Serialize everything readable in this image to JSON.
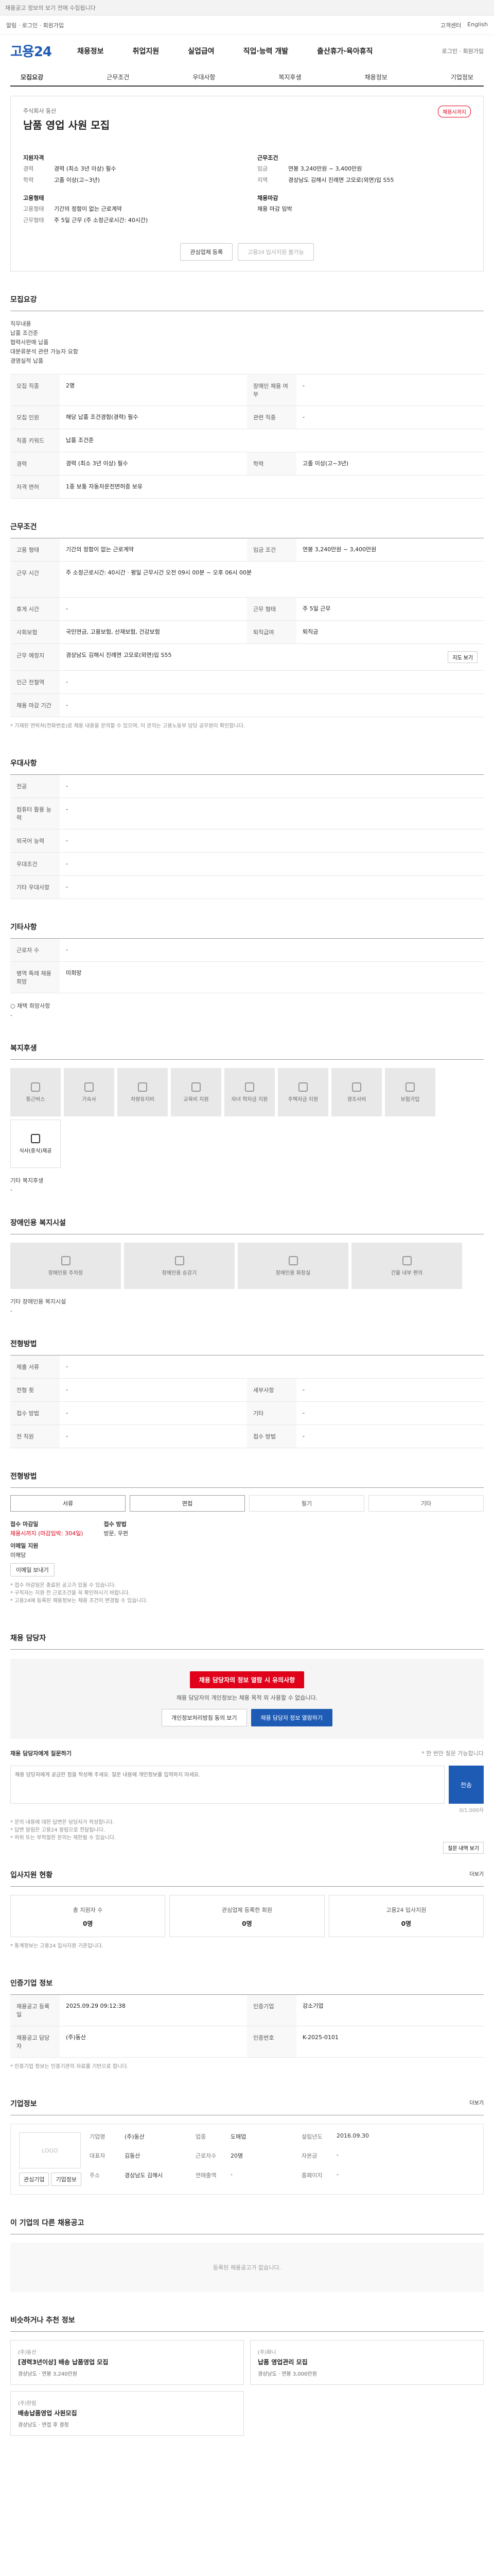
{
  "topbar": {
    "text": "채용공고 정보의 보기 전에 수집됩니다"
  },
  "subtop": {
    "left": "알림 · 로그인 · 회원가입",
    "right_items": [
      "고객센터",
      "English"
    ]
  },
  "header": {
    "logo_main": "고용",
    "logo_num": "24",
    "nav": [
      "채용정보",
      "취업지원",
      "실업급여",
      "직업·능력 개발",
      "출산휴가·육아휴직"
    ],
    "gnb_right": "로그인 · 회원가입"
  },
  "tabs": [
    "모집요강",
    "근무조건",
    "우대사항",
    "복지후생",
    "채용정보",
    "기업정보"
  ],
  "job": {
    "company": "주식회사 동산",
    "title": "남품 영업 사원 모집",
    "badge": "채용시까지",
    "left_title": "지원자격",
    "left": [
      {
        "k": "경력",
        "v": "경력 (최소 3년 이상) 필수"
      },
      {
        "k": "학력",
        "v": "고졸 이상(고~3년)"
      }
    ],
    "left_title2": "고용형태",
    "left2": [
      {
        "k": "고용형태",
        "v": "기간의 정함이 없는 근로계약"
      },
      {
        "k": "근무형태",
        "v": "주 5일 근무 (주 소정근로시간: 40시간)"
      }
    ],
    "right_title": "근무조건",
    "right": [
      {
        "k": "임금",
        "v": "연봉 3,240만원 ~ 3,400만원"
      },
      {
        "k": "지역",
        "v": "경상남도 김해시 진례면 고모로(외면)입 S55"
      }
    ],
    "right_title2": "채용마감",
    "right2": [
      {
        "k": "",
        "v": "채용 마감 임박"
      }
    ],
    "btn1": "관심업체 등록",
    "btn2": "고용24 입사지원 불가능"
  },
  "recruit": {
    "title": "모집요강",
    "desc": [
      "직무내용",
      "납품 조건준",
      "협력사판매 납품",
      "대분류분석 관련 가능자 요함",
      "경영실적 납품"
    ],
    "rows": [
      {
        "k": "모집 직종",
        "v": "2명",
        "k2": "장애인 채용 여부",
        "v2": "-"
      },
      {
        "k": "모집 인원",
        "v": "해당 납품 조건경험(경력) 필수",
        "k2": "관련 직종",
        "v2": "-"
      },
      {
        "k": "직종 키워드",
        "v": "납품 조건준",
        "k2": "",
        "v2": ""
      },
      {
        "k": "경력",
        "v": "경력 (최소 3년 이상) 필수",
        "k2": "학력",
        "v2": "고졸 이상(고~3년)"
      },
      {
        "k": "자격 면허",
        "v": "1종 보통 자동차운전면허증 보유",
        "k2": "",
        "v2": ""
      }
    ]
  },
  "conditions": {
    "title": "근무조건",
    "rows": [
      {
        "k": "고용 형태",
        "v": "기간의 정함이 없는 근로계약",
        "k2": "임금 조건",
        "v2": "연봉 3,240만원 ~ 3,400만원"
      },
      {
        "k": "근무 시간",
        "v": "주 소정근로시간: 40시간 · 평일 근무시간 오전 09시 00분 ~ 오후 06시 00분",
        "k2": "",
        "v2": ""
      },
      {
        "k": "휴게 시간",
        "v": "-",
        "k2": "근무 형태",
        "v2": "주 5일 근무"
      },
      {
        "k": "사회보험",
        "v": "국민연금, 고용보험, 산재보험, 건강보험",
        "k2": "퇴직급여",
        "v2": "퇴직금"
      },
      {
        "k": "근무 예정지",
        "v": "경상남도 김해시 진례면 고모로(외면)입 S55",
        "k2": "",
        "v2": ""
      },
      {
        "k": "인근 전철역",
        "v": "-",
        "k2": "",
        "v2": ""
      },
      {
        "k": "채용 마감 기간",
        "v": "-",
        "k2": "",
        "v2": ""
      }
    ],
    "map_btn": "지도 보기",
    "note": "* 기재된 연락처(전화번호)로 채용 내용을 문의할 수 있으며, 이 문의는 고용노동부 담당 공무원이 확인합니다."
  },
  "prefer": {
    "title": "우대사항",
    "rows": [
      {
        "k": "전공",
        "v": "-"
      },
      {
        "k": "컴퓨터 활용 능력",
        "v": "-"
      },
      {
        "k": "외국어 능력",
        "v": "-"
      },
      {
        "k": "우대조건",
        "v": "-"
      },
      {
        "k": "기타 우대사항",
        "v": "-"
      }
    ]
  },
  "etc": {
    "title": "기타사항",
    "rows": [
      {
        "k": "근로자 수",
        "v": "-"
      },
      {
        "k": "병역 특례 채용 희망",
        "v": "미희망"
      }
    ],
    "extra_title": "○ 채택 희망사항",
    "extra_val": "-"
  },
  "welfare": {
    "title": "복지후생",
    "items": [
      "통근버스",
      "기숙사",
      "차량유지비",
      "교육비 지원",
      "자녀 학자금 지원",
      "주택자금 지원",
      "경조사비",
      "보험가입",
      "식사(중식)제공"
    ],
    "other_title": "기타 복지후생",
    "other_val": "-"
  },
  "disability": {
    "title": "장애인용 복지시설",
    "items": [
      "장애인용 주차장",
      "장애인용 승강기",
      "장애인용 화장실",
      "건물 내부 편의"
    ],
    "other_title": "기타 장애인용 복지시설",
    "other_val": "-"
  },
  "process": {
    "title": "전형방법",
    "rows": [
      {
        "k": "제출 서류",
        "v": "-",
        "k2": "",
        "v2": ""
      },
      {
        "k": "전형 횟",
        "v": "-",
        "k2": "세부사항",
        "v2": "-"
      },
      {
        "k": "접수 방법",
        "v": "-",
        "k2": "기타",
        "v2": "-"
      },
      {
        "k": "전 직원",
        "v": "-",
        "k2": "접수 방법",
        "v2": "-"
      }
    ]
  },
  "apply": {
    "title": "전형방법",
    "opts": [
      "서류",
      "면접",
      "필기",
      "기타"
    ],
    "period_label": "접수 마감일",
    "period_val": "채용시까지 (마감임박: 304일)",
    "method_label": "접수 방법",
    "method_val": "방문, 우편",
    "email_label": "이메일 지원",
    "email_val": "미해당",
    "btn": "이메일 보내기",
    "notes": [
      "* 접수 마감일은 종료된 공고가 있을 수 있습니다.",
      "* 구직자는 지원 전 근로조건을 꼭 확인하시기 바랍니다.",
      "* 고용24에 등록된 채용정보는 채용 조건이 변경될 수 있습니다."
    ]
  },
  "manager": {
    "title": "채용 담당자",
    "box_title": "채용 담당자의 정보 열람 시 유의사항",
    "box_desc": "채용 담당자의 개인정보는 채용 목적 외 사용할 수 없습니다.",
    "btn1": "개인정보처리방침 동의 보기",
    "btn2": "채용 담당자 정보 열람하기",
    "qa_label": "채용 담당자에게 질문하기",
    "qa_hint": "* 한 번만 질문 가능합니다",
    "qa_placeholder": "채용 담당자에게 궁금한 점을 작성해 주세요. 질문 내용에 개인정보를 입력하지 마세요.",
    "qa_count": "0/1,000자",
    "qa_send": "전송",
    "qa_notes": [
      "* 문의 내용에 대한 답변은 담당자가 작성합니다.",
      "* 답변 알림은 고용24 알림으로 전달됩니다.",
      "* 허위 또는 부적절한 문의는 제한될 수 있습니다."
    ],
    "qa_btn": "질문 내역 보기"
  },
  "stats": {
    "title": "입사지원 현황",
    "more": "더보기",
    "items": [
      {
        "lbl": "총 지원자 수",
        "num": "0명"
      },
      {
        "lbl": "관심업체 등록한 회원",
        "num": "0명"
      },
      {
        "lbl": "고용24 입사지원",
        "num": "0명"
      }
    ],
    "note": "* 통계정보는 고용24 입사지원 기준입니다."
  },
  "recinfo": {
    "title": "인증기업 정보",
    "rows": [
      {
        "k": "채용공고 등록일",
        "v": "2025.09.29 09:12:38",
        "k2": "인증기업",
        "v2": "강소기업",
        "k3": "",
        "v3": ""
      },
      {
        "k": "채용공고 담당자",
        "v": "(주)동산",
        "k2": "인증번호",
        "v2": "K-2025-0101",
        "k3": "",
        "v3": ""
      }
    ],
    "note": "* 인증기업 정보는 인증기관의 자료를 기반으로 합니다."
  },
  "companyinfo": {
    "title": "기업정보",
    "more": "더보기",
    "logo": "LOGO",
    "fields": [
      {
        "k": "기업명",
        "v": "(주)동산"
      },
      {
        "k": "업종",
        "v": "도매업"
      },
      {
        "k": "설립년도",
        "v": "2016.09.30"
      },
      {
        "k": "대표자",
        "v": "김동산"
      },
      {
        "k": "근로자수",
        "v": "20명"
      },
      {
        "k": "자본금",
        "v": "-"
      },
      {
        "k": "주소",
        "v": "경상남도 김해시"
      },
      {
        "k": "연매출액",
        "v": "-"
      },
      {
        "k": "홈페이지",
        "v": "-"
      }
    ],
    "btn1": "관심기업",
    "btn2": "기업정보"
  },
  "samecompany": {
    "title": "이 기업의 다른 채용공고",
    "empty": "등록된 채용공고가 없습니다."
  },
  "recommend": {
    "title": "비슷하거나 추천 정보",
    "items": [
      {
        "t": "(주)동산",
        "title": "[경력3년이상] 배송 납품영업 모집",
        "meta": "경상남도 · 연봉 3,240만원"
      },
      {
        "t": "(주)화니",
        "title": "납품 영업관리 모집",
        "meta": "경상남도 · 연봉 3,000만원"
      },
      {
        "t": "(주)한림",
        "title": "배송납품영업 사원모집",
        "meta": "경상남도 · 면접 후 결정"
      }
    ]
  }
}
